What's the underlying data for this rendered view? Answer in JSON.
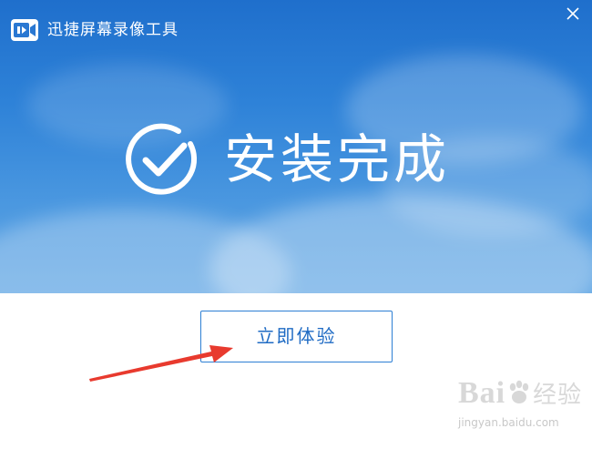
{
  "window": {
    "app_title": "迅捷屏幕录像工具",
    "logo_icon": "video-camera-icon",
    "close_icon": "close-icon"
  },
  "banner": {
    "status_icon": "check-circle-icon",
    "status_text": "安装完成"
  },
  "actions": {
    "start_label": "立即体验"
  },
  "overlay": {
    "arrow_icon": "red-arrow-annotation",
    "watermark_brand_prefix": "Bai",
    "watermark_brand_suffix": "经验",
    "watermark_url": "jingyan.baidu.com"
  },
  "colors": {
    "banner_top": "#1f6fcc",
    "banner_bottom": "#5da4e3",
    "button_border": "#2d7fd4",
    "button_text": "#1f6bc4",
    "arrow": "#e83a2e"
  }
}
